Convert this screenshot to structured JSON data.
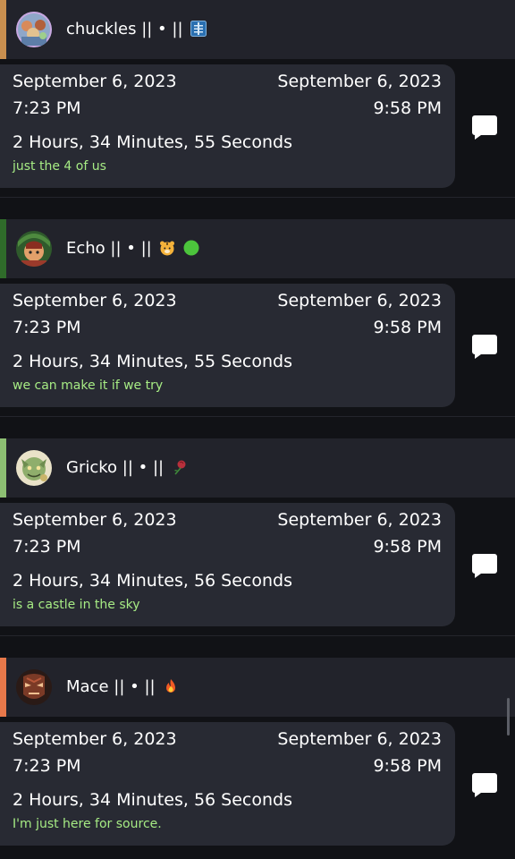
{
  "entries": [
    {
      "name": "chuckles || • ||",
      "emoji": "x-ray",
      "accent_color": "#c98f4f",
      "start_date": "September 6, 2023",
      "start_time": "7:23 PM",
      "end_date": "September 6, 2023",
      "end_time": "9:58 PM",
      "duration": "2 Hours, 34 Minutes, 55 Seconds",
      "note": "just the 4 of us"
    },
    {
      "name": "Echo || • ||",
      "emoji": "tiger-face, green-circle",
      "accent_color": "#2f6b2a",
      "start_date": "September 6, 2023",
      "start_time": "7:23 PM",
      "end_date": "September 6, 2023",
      "end_time": "9:58 PM",
      "duration": "2 Hours, 34 Minutes, 55 Seconds",
      "note": "we can make it if we try"
    },
    {
      "name": "Gricko || • ||",
      "emoji": "rose",
      "accent_color": "#8dbf73",
      "start_date": "September 6, 2023",
      "start_time": "7:23 PM",
      "end_date": "September 6, 2023",
      "end_time": "9:58 PM",
      "duration": "2 Hours, 34 Minutes, 56 Seconds",
      "note": "is a castle in the sky"
    },
    {
      "name": "Mace || • ||",
      "emoji": "fire",
      "accent_color": "#e8784a",
      "start_date": "September 6, 2023",
      "start_time": "7:23 PM",
      "end_date": "September 6, 2023",
      "end_time": "9:58 PM",
      "duration": "2 Hours, 34 Minutes, 56 Seconds",
      "note": "I'm just here for source."
    }
  ],
  "colors": {
    "background": "#111216",
    "header": "#22232b",
    "card": "#282a33",
    "note_text": "#a6eb84"
  },
  "icons": {
    "comment": "comment-icon"
  }
}
